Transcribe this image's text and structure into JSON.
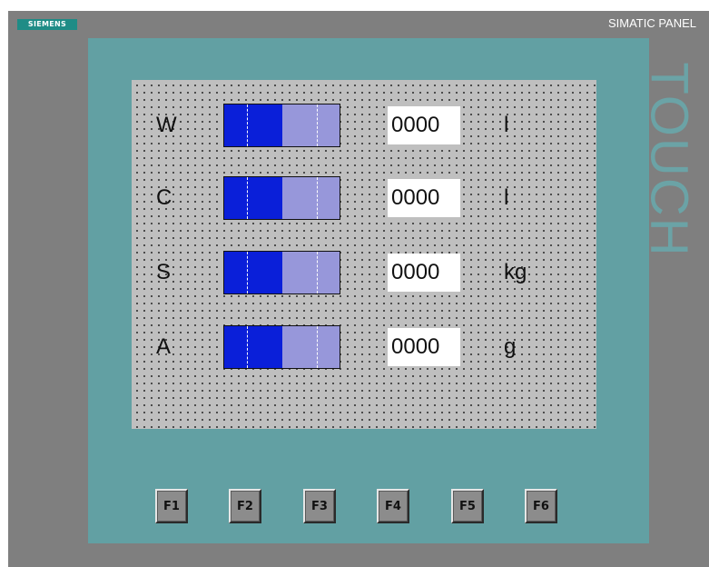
{
  "device": {
    "brand": "SIEMENS",
    "model": "SIMATIC PANEL",
    "touch_label": "TOUCH"
  },
  "rows": [
    {
      "name": "W",
      "value": "0000",
      "unit": "l",
      "bar_fill_fraction": 0.5
    },
    {
      "name": "C",
      "value": "0000",
      "unit": "l",
      "bar_fill_fraction": 0.5
    },
    {
      "name": "S",
      "value": "0000",
      "unit": "kg",
      "bar_fill_fraction": 0.5
    },
    {
      "name": "A",
      "value": "0000",
      "unit": "g",
      "bar_fill_fraction": 0.5
    }
  ],
  "function_keys": [
    "F1",
    "F2",
    "F3",
    "F4",
    "F5",
    "F6"
  ],
  "colors": {
    "housing": "#7f7f7f",
    "bezel": "#62a0a3",
    "screen": "#bfbfbf",
    "bar_fill": "#0a1fd9",
    "bar_track": "#9797da",
    "brand_badge": "#1f8c86"
  }
}
